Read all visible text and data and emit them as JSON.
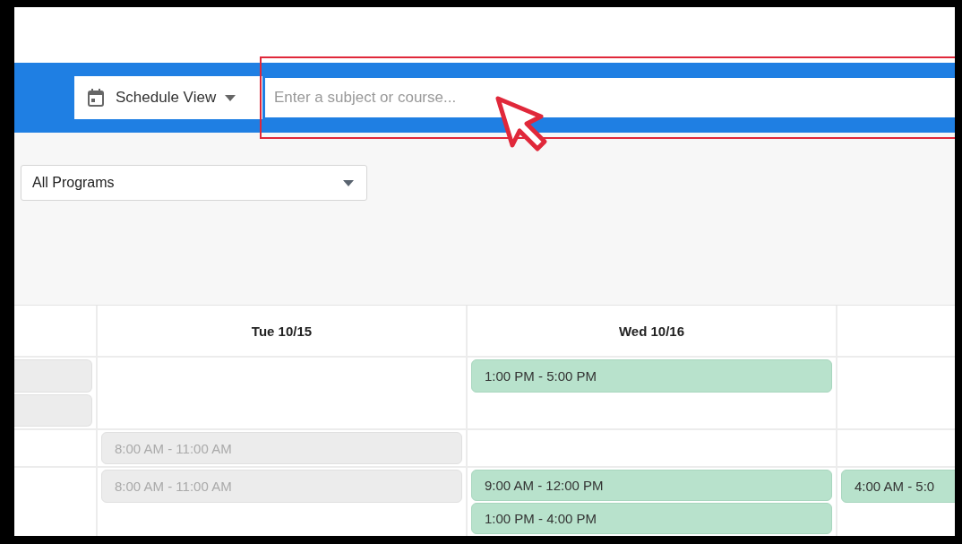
{
  "toolbar": {
    "view_select": {
      "value": "Schedule View"
    },
    "search": {
      "placeholder": "Enter a subject or course..."
    }
  },
  "filters": {
    "program_select": {
      "value": "All Programs"
    }
  },
  "schedule": {
    "columns": [
      {},
      {
        "label": "Tue 10/15"
      },
      {
        "label": "Wed 10/16"
      },
      {}
    ],
    "rows": [
      {
        "cells": [
          [
            {
              "kind": "past"
            },
            {
              "kind": "past"
            }
          ],
          [],
          [
            {
              "kind": "available",
              "time": "1:00 PM - 5:00 PM"
            }
          ],
          []
        ]
      },
      {
        "cells": [
          [],
          [
            {
              "kind": "past",
              "time": "8:00 AM - 11:00 AM"
            }
          ],
          [],
          []
        ]
      },
      {
        "cells": [
          [],
          [
            {
              "kind": "past",
              "time": "8:00 AM - 11:00 AM"
            }
          ],
          [
            {
              "kind": "available",
              "time": "9:00 AM - 12:00 PM"
            },
            {
              "kind": "available",
              "time": "1:00 PM - 4:00 PM"
            }
          ],
          [
            {
              "kind": "available",
              "time": "4:00 AM - 5:0"
            }
          ]
        ]
      }
    ]
  }
}
